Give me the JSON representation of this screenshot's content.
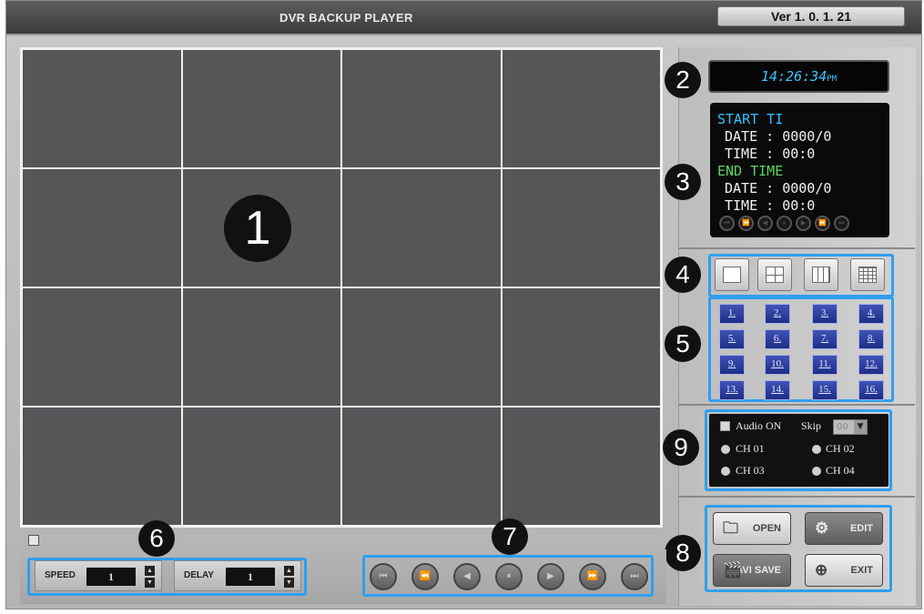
{
  "app": {
    "title": "DVR BACKUP PLAYER",
    "version": "Ver 1. 0. 1. 21"
  },
  "badges": {
    "b1": "1",
    "b2": "2",
    "b3": "3",
    "b4": "4",
    "b5": "5",
    "b6": "6",
    "b7": "7",
    "b8": "8",
    "b9": "9"
  },
  "clock": {
    "time": "14:26:34",
    "suffix": "PM"
  },
  "info": {
    "start_label": "START TI",
    "start_date": "DATE : 0000/0",
    "start_time": "TIME : 00:0",
    "end_label": "END TIME",
    "end_date": "DATE : 0000/0",
    "end_time": "TIME : 00:0"
  },
  "mini_controls": [
    "⏮",
    "⏪",
    "◀",
    "⏸",
    "▶",
    "⏩",
    "⏭"
  ],
  "channels": [
    "1.",
    "2.",
    "3.",
    "4.",
    "5.",
    "6.",
    "7.",
    "8.",
    "9.",
    "10.",
    "11.",
    "12.",
    "13.",
    "14.",
    "15.",
    "16."
  ],
  "audio": {
    "label": "Audio ON",
    "skip_label": "Skip",
    "skip_value": "00",
    "ch1": "CH 01",
    "ch2": "CH 02",
    "ch3": "CH 03",
    "ch4": "CH 04"
  },
  "actions": {
    "open": "OPEN",
    "edit": "EDIT",
    "avisave": "AVI SAVE",
    "exit": "EXIT"
  },
  "speed": {
    "label": "SPEED",
    "value": "1"
  },
  "delay": {
    "label": "DELAY",
    "value": "1"
  },
  "playback": [
    "⏮",
    "⏪",
    "◀",
    "⏸",
    "▶",
    "⏩",
    "⏭"
  ],
  "colors": {
    "highlight": "#2e9ff0",
    "clock_text": "#38c8ff",
    "info_heading": "#27c6ff",
    "info_end": "#5bd65b",
    "channel_button": "#2a3ea0"
  }
}
